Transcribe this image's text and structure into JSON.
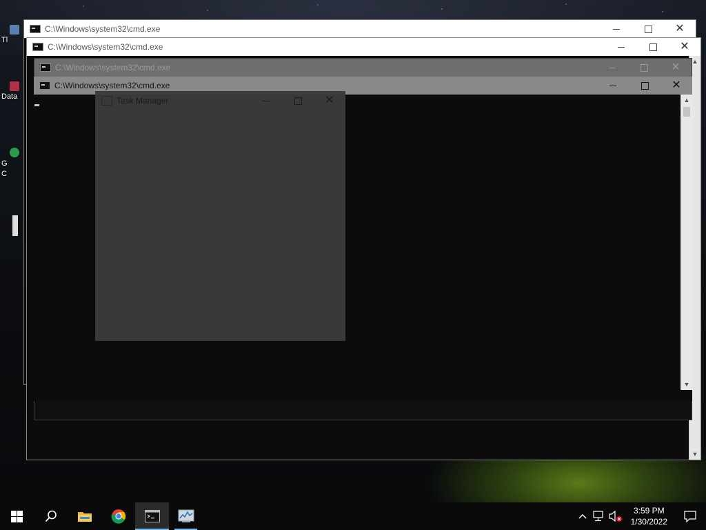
{
  "desktop": {
    "icons": [
      {
        "name": "desktop-icon-t",
        "label": "Tl"
      },
      {
        "name": "desktop-icon-data",
        "label": "Data"
      },
      {
        "name": "desktop-icon-google-chrome",
        "label": "G\nC"
      }
    ]
  },
  "windows": {
    "cmd_back": {
      "title": "C:\\Windows\\system32\\cmd.exe"
    },
    "cmd_second": {
      "title": "C:\\Windows\\system32\\cmd.exe"
    },
    "cmd_ghost": {
      "title": "C:\\Windows\\system32\\cmd.exe"
    },
    "cmd_front": {
      "title": "C:\\Windows\\system32\\cmd.exe"
    },
    "task_manager": {
      "title": "Task Manager"
    }
  },
  "window_controls": {
    "minimize": "—",
    "maximize": "☐",
    "close": "✕"
  },
  "taskbar": {
    "pinned": [
      {
        "name": "start-button",
        "icon": "windows-logo-icon"
      },
      {
        "name": "search-button",
        "icon": "search-icon"
      },
      {
        "name": "file-explorer-button",
        "icon": "folder-icon"
      },
      {
        "name": "chrome-button",
        "icon": "chrome-icon"
      },
      {
        "name": "cmd-taskbar-button",
        "icon": "terminal-icon",
        "active": true
      },
      {
        "name": "task-manager-taskbar-button",
        "icon": "task-manager-icon"
      }
    ],
    "tray": {
      "time": "3:59 PM",
      "date": "1/30/2022"
    }
  },
  "colors": {
    "accent": "#76b9ed",
    "console_bg": "#0c0c0c",
    "titlebar_bg": "#ffffff",
    "task_manager_bg": "#3b3b3b"
  }
}
